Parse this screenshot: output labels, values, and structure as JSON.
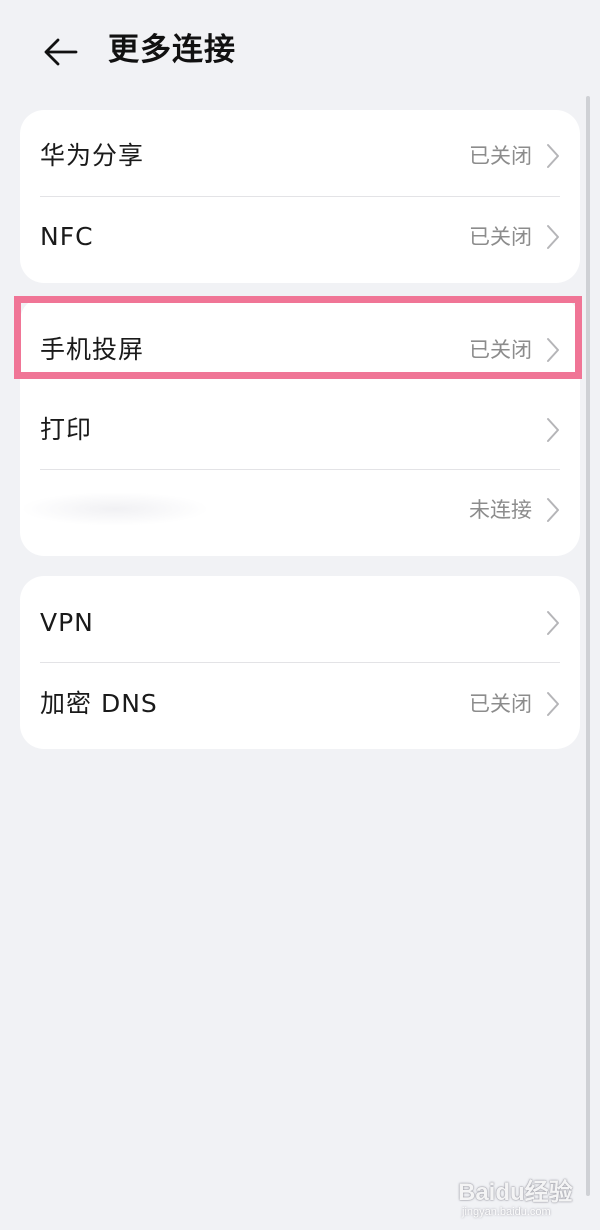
{
  "header": {
    "back_icon": "arrow-left-icon",
    "title": "更多连接"
  },
  "groups": [
    {
      "items": [
        {
          "label": "华为分享",
          "value": "已关闭"
        },
        {
          "label": "NFC",
          "value": "已关闭"
        }
      ]
    },
    {
      "items": [
        {
          "label": "手机投屏",
          "value": "已关闭",
          "highlighted": true
        },
        {
          "label": "打印",
          "value": ""
        },
        {
          "label": "",
          "value": "未连接"
        }
      ]
    },
    {
      "items": [
        {
          "label": "VPN",
          "value": ""
        },
        {
          "label": "加密 DNS",
          "value": "已关闭"
        }
      ]
    }
  ],
  "icons": {
    "chevron": "chevron-right-icon"
  },
  "colors": {
    "background": "#f1f2f5",
    "card": "#ffffff",
    "highlight_border": "#f07596",
    "secondary_text": "#8c8c8c"
  },
  "watermark": {
    "text": "Baidu经验",
    "url": "jingyan.baidu.com"
  }
}
